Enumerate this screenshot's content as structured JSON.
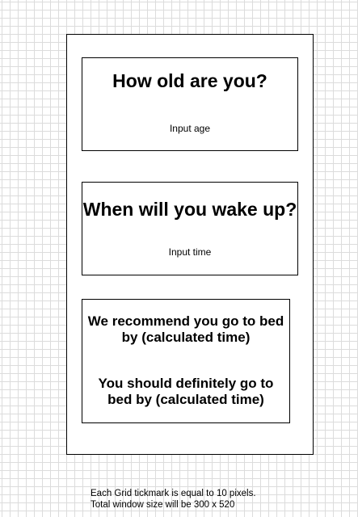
{
  "age_card": {
    "heading": "How old are you?",
    "input_label": "Input age"
  },
  "wake_card": {
    "heading": "When will you wake up?",
    "input_label": "Input time"
  },
  "result_card": {
    "recommend_line_1": "We recommend you go to bed",
    "recommend_line_2": "by (calculated time)",
    "definite_line_1": "You should definitely go to",
    "definite_line_2": "bed by (calculated time)"
  },
  "footnote": {
    "line_1": "Each Grid tickmark is equal to 10 pixels.",
    "line_2": "Total window size will be  300 x 520"
  }
}
